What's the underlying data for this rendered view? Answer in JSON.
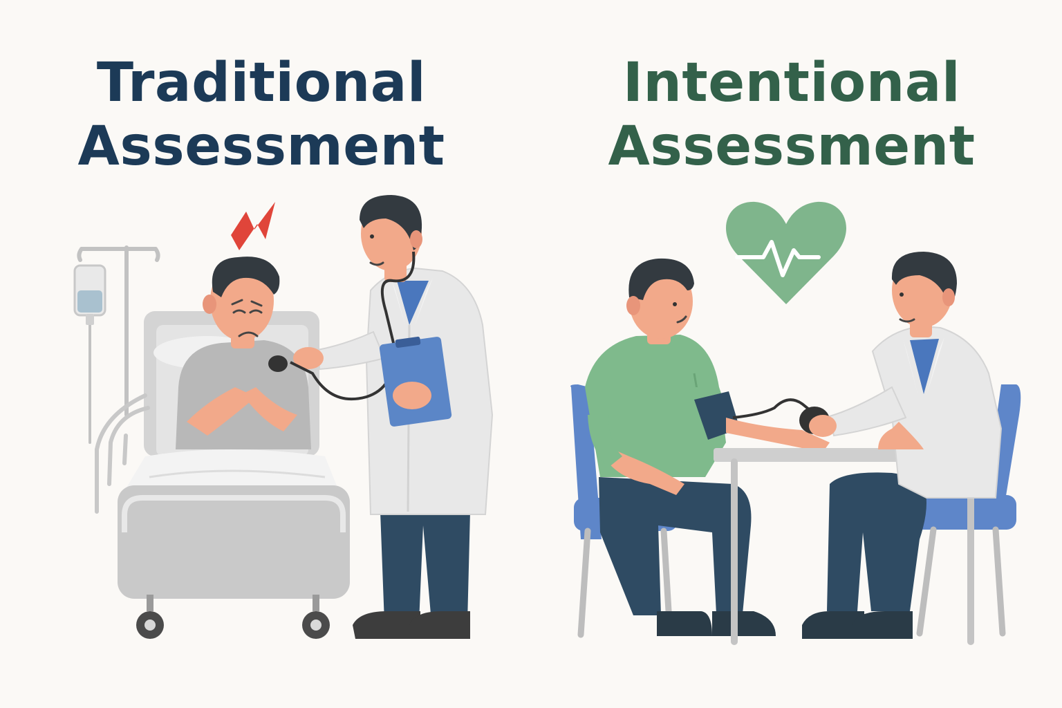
{
  "colors": {
    "background": "#fbf9f6",
    "traditional_title": "#1c3a57",
    "intentional_title": "#33614a",
    "scrubs_blue": "#4a77bd",
    "chair_blue": "#5e86c9",
    "heart_green": "#7fb58c",
    "shirt_green": "#7fba8c",
    "pants_navy": "#2f4b63",
    "skin": "#f2a98a",
    "hair": "#333a40",
    "lab_coat": "#e8e8e8",
    "bed_grey": "#c9c9c9",
    "alert_red": "#e0453a"
  },
  "panels": {
    "traditional": {
      "title_line1": "Traditional",
      "title_line2": "Assessment"
    },
    "intentional": {
      "title_line1": "Intentional",
      "title_line2": "Assessment"
    }
  },
  "icons": {
    "stress": "lightning-icon",
    "health": "heart-pulse-icon"
  }
}
